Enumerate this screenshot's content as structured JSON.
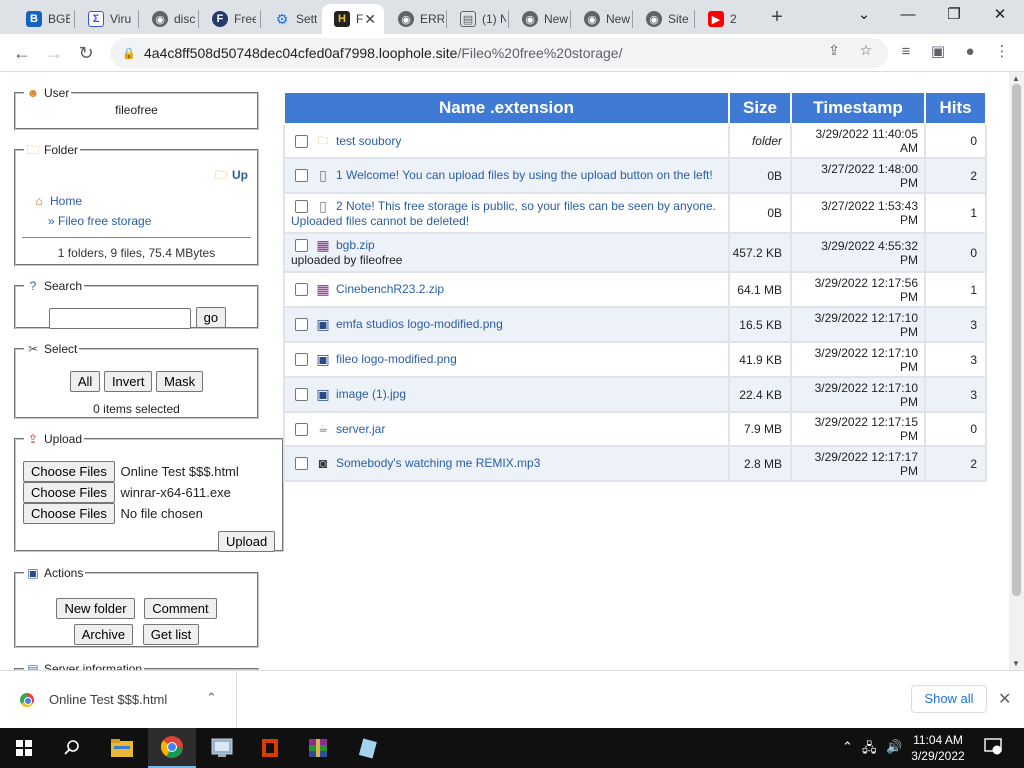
{
  "browser": {
    "tabs": [
      {
        "label": "BGB",
        "icon": "bgb-icon"
      },
      {
        "label": "Viru",
        "icon": "virustotal-icon"
      },
      {
        "label": "disc",
        "icon": "globe-icon"
      },
      {
        "label": "Free",
        "icon": "firefox-icon"
      },
      {
        "label": "Sett",
        "icon": "settings-gear-icon"
      },
      {
        "label": "F",
        "icon": "hfs-icon",
        "active": true
      },
      {
        "label": "ERR",
        "icon": "globe-icon"
      },
      {
        "label": "(1) N",
        "icon": "document-icon"
      },
      {
        "label": "New",
        "icon": "chrome-icon"
      },
      {
        "label": "New",
        "icon": "chrome-icon"
      },
      {
        "label": "Site",
        "icon": "globe-icon"
      },
      {
        "label": "2",
        "icon": "youtube-icon"
      }
    ],
    "url_host": "4a4c8ff508d50748dec04cfed0af7998.loophole.site",
    "url_path": "/Fileo%20free%20storage/"
  },
  "user": {
    "legend": "User",
    "name": "fileofree"
  },
  "folder": {
    "legend": "Folder",
    "up_label": "Up",
    "home_label": "Home",
    "current_label": "» Fileo free storage",
    "summary": "1 folders, 9 files, 75.4 MBytes"
  },
  "search": {
    "legend": "Search",
    "go_label": "go"
  },
  "select": {
    "legend": "Select",
    "all_label": "All",
    "invert_label": "Invert",
    "mask_label": "Mask",
    "status": "0 items selected"
  },
  "upload": {
    "legend": "Upload",
    "choose_label": "Choose Files",
    "files": [
      "Online Test $$$.html",
      "winrar-x64-611.exe",
      "No file chosen"
    ],
    "upload_label": "Upload"
  },
  "actions": {
    "legend": "Actions",
    "new_folder_label": "New folder",
    "comment_label": "Comment",
    "archive_label": "Archive",
    "getlist_label": "Get list"
  },
  "server_info": {
    "legend": "Server information"
  },
  "table": {
    "headers": {
      "name": "Name .extension",
      "size": "Size",
      "timestamp": "Timestamp",
      "hits": "Hits"
    },
    "rows": [
      {
        "icon": "folder-icon",
        "name": "test soubory",
        "size": "folder",
        "time1": "3/29/2022 11:40:05",
        "time2": "AM",
        "hits": "0"
      },
      {
        "icon": "file-icon",
        "name": "1 Welcome! You can upload files by using the upload button on the left!",
        "size": "0B",
        "time1": "3/27/2022 1:48:00",
        "time2": "PM",
        "hits": "2"
      },
      {
        "icon": "file-icon",
        "name": "2 Note! This free storage is public, so your files can be seen by anyone. Uploaded files cannot be deleted!",
        "size": "0B",
        "time1": "3/27/2022 1:53:43",
        "time2": "PM",
        "hits": "1"
      },
      {
        "icon": "archive-icon",
        "name": "bgb.zip",
        "comment": "uploaded by fileofree",
        "size": "457.2 KB",
        "time1": "3/29/2022 4:55:32",
        "time2": "PM",
        "hits": "0"
      },
      {
        "icon": "archive-icon",
        "name": "CinebenchR23.2.zip",
        "size": "64.1 MB",
        "time1": "3/29/2022 12:17:56",
        "time2": "PM",
        "hits": "1"
      },
      {
        "icon": "image-icon",
        "name": "emfa studios logo-modified.png",
        "size": "16.5 KB",
        "time1": "3/29/2022 12:17:10",
        "time2": "PM",
        "hits": "3"
      },
      {
        "icon": "image-icon",
        "name": "fileo logo-modified.png",
        "size": "41.9 KB",
        "time1": "3/29/2022 12:17:10",
        "time2": "PM",
        "hits": "3"
      },
      {
        "icon": "image-icon",
        "name": "image (1).jpg",
        "size": "22.4 KB",
        "time1": "3/29/2022 12:17:10",
        "time2": "PM",
        "hits": "3"
      },
      {
        "icon": "jar-icon",
        "name": "server.jar",
        "size": "7.9 MB",
        "time1": "3/29/2022 12:17:15",
        "time2": "PM",
        "hits": "0"
      },
      {
        "icon": "audio-icon",
        "name": "Somebody's watching me REMIX.mp3",
        "size": "2.8 MB",
        "time1": "3/29/2022 12:17:17",
        "time2": "PM",
        "hits": "2"
      }
    ]
  },
  "downloads": {
    "item_name": "Online Test $$$.html",
    "show_all_label": "Show all"
  },
  "taskbar": {
    "time": "11:04 AM",
    "date": "3/29/2022"
  },
  "colors": {
    "header_blue": "#3f7bd4",
    "link_blue": "#2b5ea8",
    "row_alt": "#edf1f8"
  }
}
